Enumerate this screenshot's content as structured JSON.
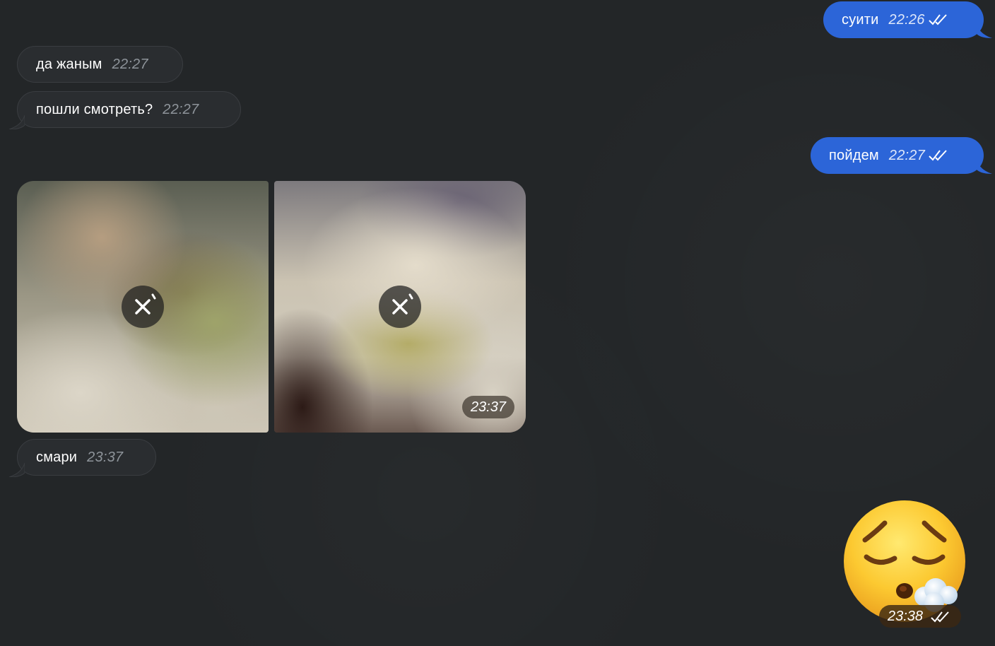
{
  "messages": [
    {
      "direction": "out",
      "text": "суити",
      "time": "22:26"
    },
    {
      "direction": "in",
      "text": "да жаным",
      "time": "22:27"
    },
    {
      "direction": "in",
      "text": "пошли смотреть?",
      "time": "22:27"
    },
    {
      "direction": "out",
      "text": "пойдем",
      "time": "22:27"
    },
    {
      "direction": "in",
      "text": "смари",
      "time": "23:37"
    }
  ],
  "album": {
    "time": "23:37",
    "photos": [
      {
        "icon": "cancel-download-icon"
      },
      {
        "icon": "cancel-download-icon"
      }
    ]
  },
  "sticker": {
    "emoji": "sleeping-pensive-face",
    "time": "23:38"
  },
  "colors": {
    "background": "#232628",
    "incoming_bubble": "#2a2d30",
    "outgoing_bubble": "#2c65d8"
  }
}
